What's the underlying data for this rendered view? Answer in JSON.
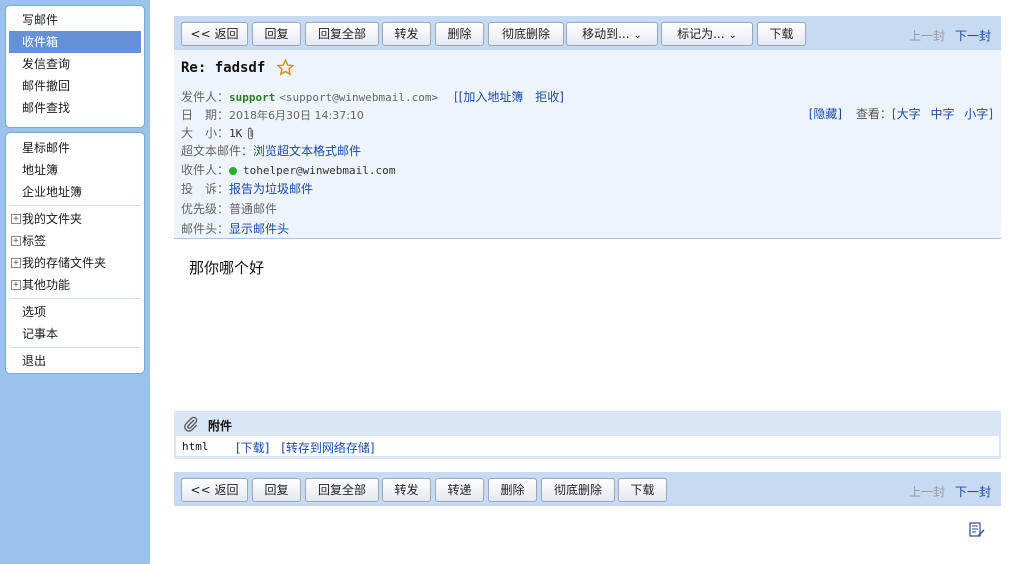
{
  "sidebar": {
    "group1": [
      "写邮件",
      "收件箱",
      "发信查询",
      "邮件撤回",
      "邮件查找"
    ],
    "group1_active": "收件箱",
    "group2": [
      "星标邮件",
      "地址簿",
      "企业地址簿"
    ],
    "group3": [
      "我的文件夹",
      "标签",
      "我的存储文件夹",
      "其他功能"
    ],
    "group4": [
      "选项",
      "记事本"
    ],
    "group5": [
      "退出"
    ],
    "plus_sign": "+"
  },
  "toolbar_top": {
    "back": "<< 返回",
    "reply": "回复",
    "reply_all": "回复全部",
    "forward": "转发",
    "delete": "删除",
    "delete_permanent": "彻底删除",
    "move_to": "移动到...",
    "mark_as": "标记为...",
    "download": "下载",
    "prev": "上一封",
    "next": "下一封"
  },
  "toolbar_bottom": {
    "back": "<< 返回",
    "reply": "回复",
    "reply_all": "回复全部",
    "forward": "转发",
    "redirect": "转递",
    "delete": "删除",
    "delete_permanent": "彻底删除",
    "download": "下载",
    "prev": "上一封",
    "next": "下一封"
  },
  "mail": {
    "subject": "Re: fadsdf",
    "sender_label": "发件人：",
    "sender_name": "support",
    "sender_addr": "<support@winwebmail.com>",
    "add_contact": "[加入地址簿",
    "reject": "拒收]",
    "date_label": "日　期：",
    "date": "2018年6月30日 14:37:10",
    "size_label": "大　小：",
    "size": "1K",
    "hypertext_label": "超文本邮件：",
    "hypertext_link": "浏览超文本格式邮件",
    "to_label": "收件人：",
    "to": "tohelper@winwebmail.com",
    "complaint_label": "投　诉：",
    "complaint_link": "报告为垃圾邮件",
    "priority_label": "优先级：",
    "priority": "普通邮件",
    "headers_label": "邮件头：",
    "headers_link": "显示邮件头",
    "body": "那你哪个好"
  },
  "view": {
    "hide": "[隐藏]",
    "view_label": "查看：[",
    "large": "大字",
    "medium": "中字",
    "small": "小字",
    "close_bracket": "]"
  },
  "attachments": {
    "title": "附件",
    "files": [
      {
        "name": "html",
        "download": "[下载]",
        "save": "[转存到网络存储]"
      }
    ]
  },
  "colors": {
    "sidebar_bg": "#9bc2ea",
    "active_item": "#6591d6",
    "toolbar_bg": "#c6daf2",
    "link": "#1b4aa6",
    "sender_green": "#2e7d1c"
  }
}
